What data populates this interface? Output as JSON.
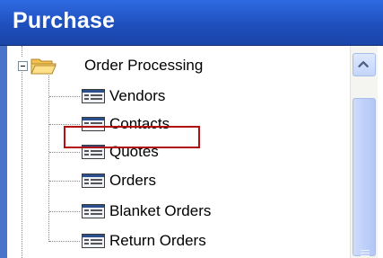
{
  "header": {
    "title": "Purchase"
  },
  "tree": {
    "root": {
      "label": "Order Processing",
      "expanded": true,
      "icon": "folder-open-icon"
    },
    "children": [
      {
        "label": "Vendors",
        "icon": "list-icon"
      },
      {
        "label": "Contacts",
        "icon": "list-icon"
      },
      {
        "label": "Quotes",
        "icon": "list-icon"
      },
      {
        "label": "Orders",
        "icon": "list-icon",
        "highlighted": true
      },
      {
        "label": "Blanket Orders",
        "icon": "list-icon"
      },
      {
        "label": "Return Orders",
        "icon": "list-icon"
      }
    ]
  },
  "colors": {
    "header_bg": "#1f4fbd",
    "highlight_border": "#b01010",
    "scrollbar_thumb": "#bfd0f9"
  }
}
